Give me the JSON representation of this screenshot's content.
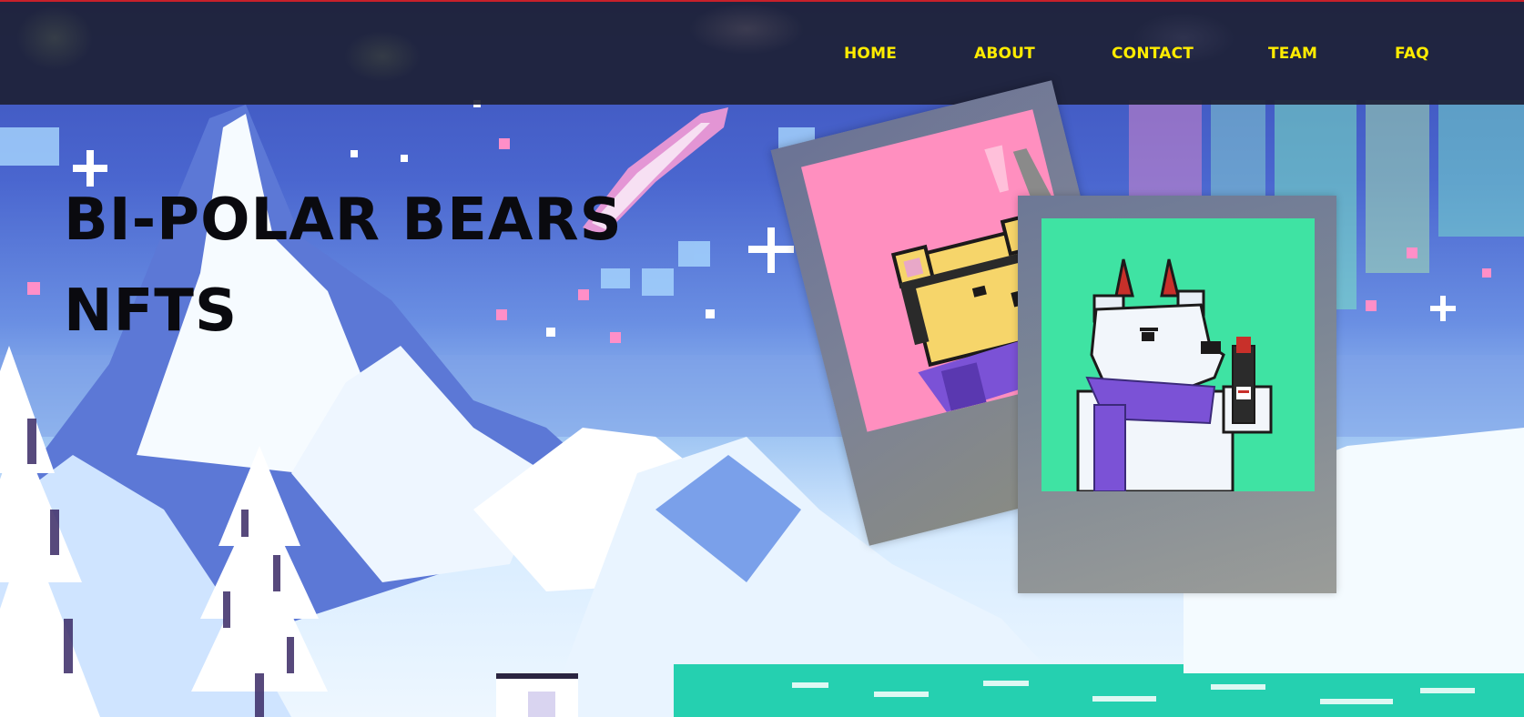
{
  "nav": {
    "items": [
      {
        "label": "HOME"
      },
      {
        "label": "ABOUT"
      },
      {
        "label": "CONTACT"
      },
      {
        "label": "TEAM"
      },
      {
        "label": "FAQ"
      }
    ]
  },
  "hero": {
    "title_line1": "BI-POLAR BEARS",
    "title_line2": "NFTS"
  },
  "colors": {
    "nav_text": "#ffec00",
    "header_bg": "#1e2137",
    "header_top_border": "#c8202a",
    "title_text": "#0a0a0f",
    "card_back_art": "#ff8fbf",
    "card_front_art": "#3fe3a3"
  }
}
